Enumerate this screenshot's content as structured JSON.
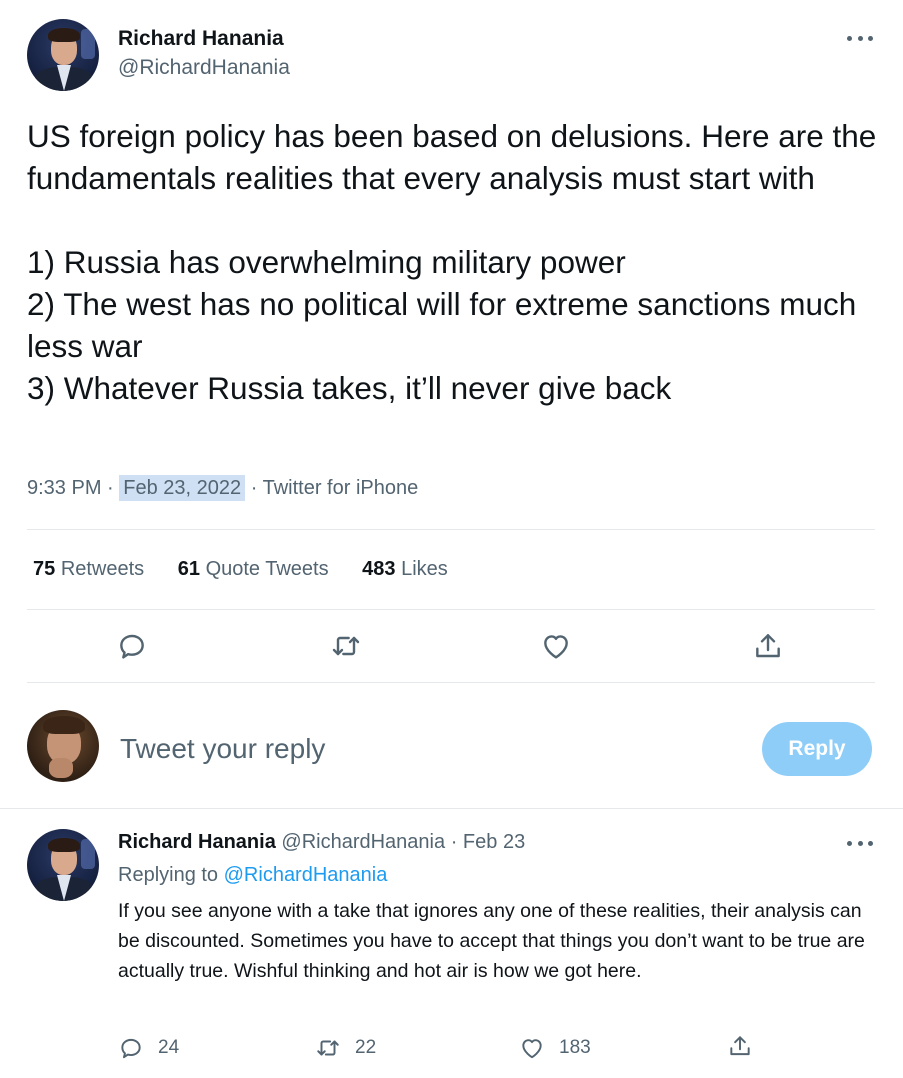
{
  "main_tweet": {
    "author_name": "Richard Hanania",
    "author_handle": "@RichardHanania",
    "text": "US foreign policy has been based on delusions. Here are the fundamentals realities that every analysis must start with\n\n1) Russia has overwhelming military power\n2) The west has no political will for extreme sanctions much less war\n3) Whatever Russia takes, it’ll never give back",
    "time": "9:33 PM",
    "separator": "·",
    "date": "Feb 23, 2022",
    "source": "Twitter for iPhone",
    "stats": {
      "retweets_count": "75",
      "retweets_label": "Retweets",
      "quotes_count": "61",
      "quotes_label": "Quote Tweets",
      "likes_count": "483",
      "likes_label": "Likes"
    }
  },
  "reply_box": {
    "placeholder": "Tweet your reply",
    "button_label": "Reply"
  },
  "reply_tweet": {
    "author_name": "Richard Hanania",
    "author_handle": "@RichardHanania",
    "separator": "·",
    "date": "Feb 23",
    "replying_prefix": "Replying to",
    "replying_to": "@RichardHanania",
    "text": "If you see anyone with a take that ignores any one of these realities, their analysis can be discounted. Sometimes you have to accept that things you don’t want to be true are actually true. Wishful thinking and hot air is how we got here.",
    "reply_count": "24",
    "retweet_count": "22",
    "like_count": "183"
  },
  "icons": {
    "reply": "speech-bubble-icon",
    "retweet": "retweet-arrows-icon",
    "like": "heart-icon",
    "share": "share-upload-icon",
    "more": "more-dots-icon"
  },
  "colors": {
    "text": "#0f1419",
    "secondary": "#536471",
    "link": "#1d9bf0",
    "reply_button": "#8ecdf8",
    "date_highlight": "#cfe0f5"
  }
}
